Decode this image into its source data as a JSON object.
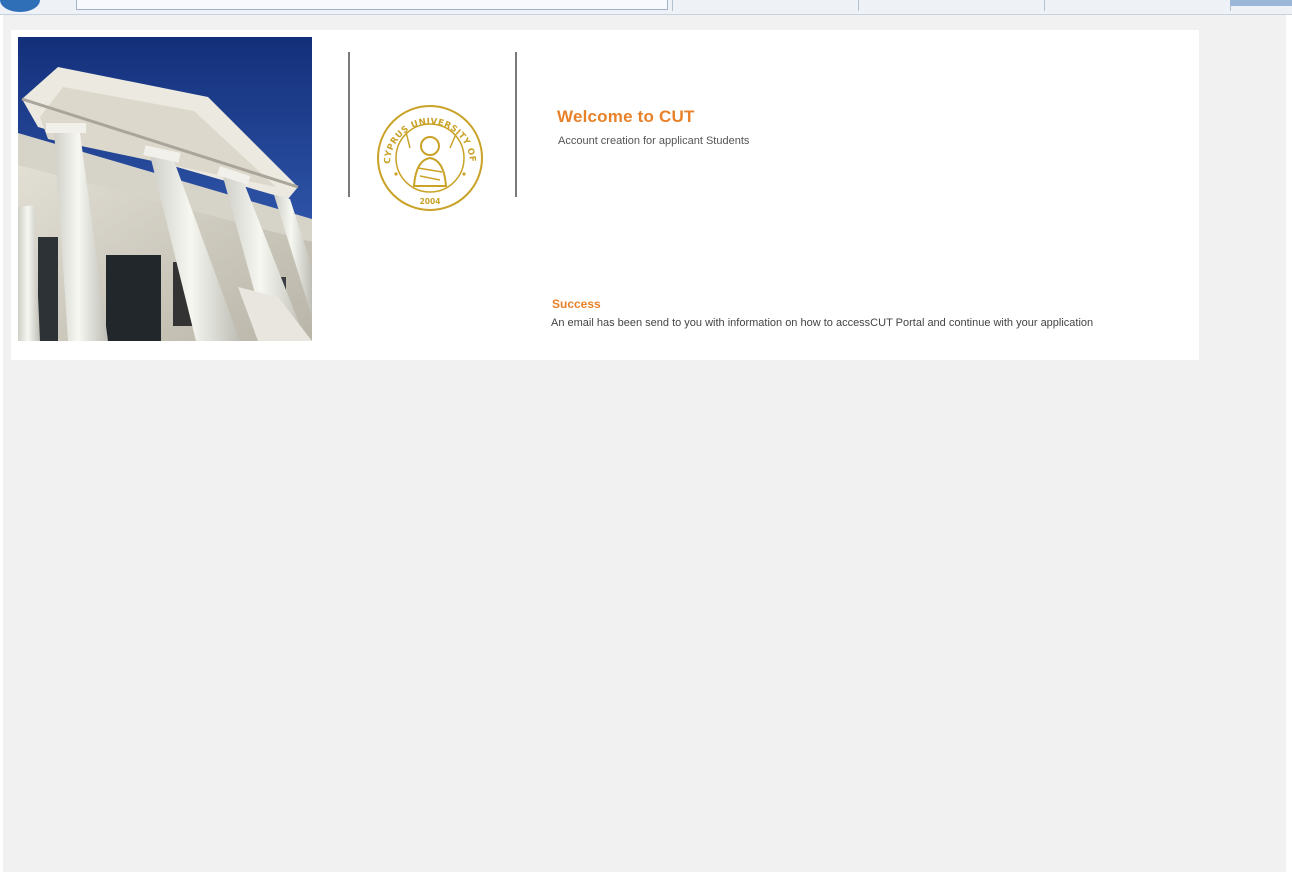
{
  "header": {
    "title": "Welcome to CUT",
    "subtitle": "Account creation for applicant Students"
  },
  "logo": {
    "name": "university-seal",
    "text": "CYPRUS UNIVERSITY OF TECHNOLOGY",
    "year": "2004",
    "color": "#c9a227"
  },
  "status": {
    "label": "Success",
    "message": "An email has been send to you with information on how to accessCUT Portal and continue with your application"
  },
  "colors": {
    "accent": "#e8822a",
    "background": "#f1f1f1",
    "card": "#ffffff"
  }
}
